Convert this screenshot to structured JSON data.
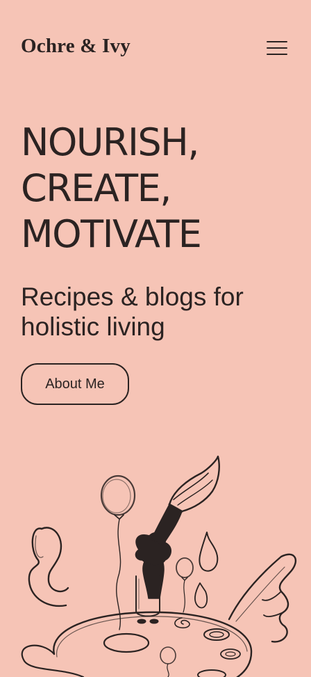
{
  "header": {
    "logo": "Ochre & Ivy",
    "menu_icon": "hamburger-menu-icon"
  },
  "hero": {
    "title_lines": [
      "NOURISH,",
      "CREATE,",
      "MOTIVATE"
    ],
    "subtitle": "Recipes & blogs for holistic living",
    "cta_label": "About Me"
  },
  "illustration": {
    "icon": "paintbrush-figure-illustration"
  },
  "colors": {
    "background": "#f6c4b6",
    "text": "#2b2322"
  }
}
